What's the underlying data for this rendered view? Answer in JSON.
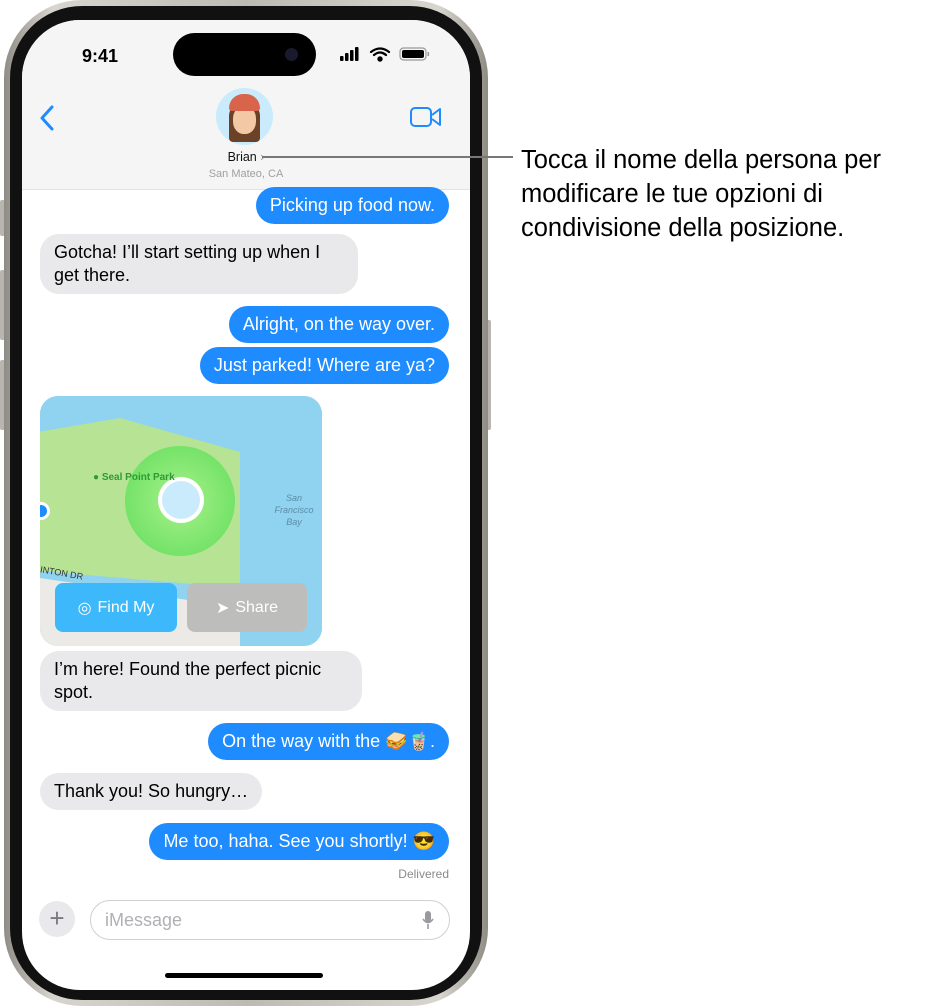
{
  "status": {
    "time": "9:41"
  },
  "header": {
    "contact_name": "Brian",
    "contact_location": "San Mateo, CA"
  },
  "messages": [
    {
      "dir": "out",
      "text": "Picking up food now."
    },
    {
      "dir": "in",
      "text": "Gotcha! I’ll start setting up when I get there."
    },
    {
      "dir": "out",
      "text": "Alright, on the way over."
    },
    {
      "dir": "out",
      "text": "Just parked! Where are ya?"
    },
    {
      "dir": "in",
      "text": "I’m here! Found the perfect picnic spot."
    },
    {
      "dir": "out",
      "text": "On the way with the 🥪🧋."
    },
    {
      "dir": "in",
      "text": "Thank you! So hungry…"
    },
    {
      "dir": "out",
      "text": "Me too, haha. See you shortly! 😎"
    }
  ],
  "map": {
    "park_label": "Seal Point Park",
    "bay_label": "San Francisco Bay",
    "street_label": "INTON DR",
    "find_my_label": "Find My",
    "share_label": "Share"
  },
  "delivered": "Delivered",
  "composer": {
    "placeholder": "iMessage"
  },
  "annotation": "Tocca il nome della persona per modificare le tue opzioni di condivisione della posizione.",
  "colors": {
    "accent": "#1e8bff",
    "incoming": "#e9e9eb"
  }
}
